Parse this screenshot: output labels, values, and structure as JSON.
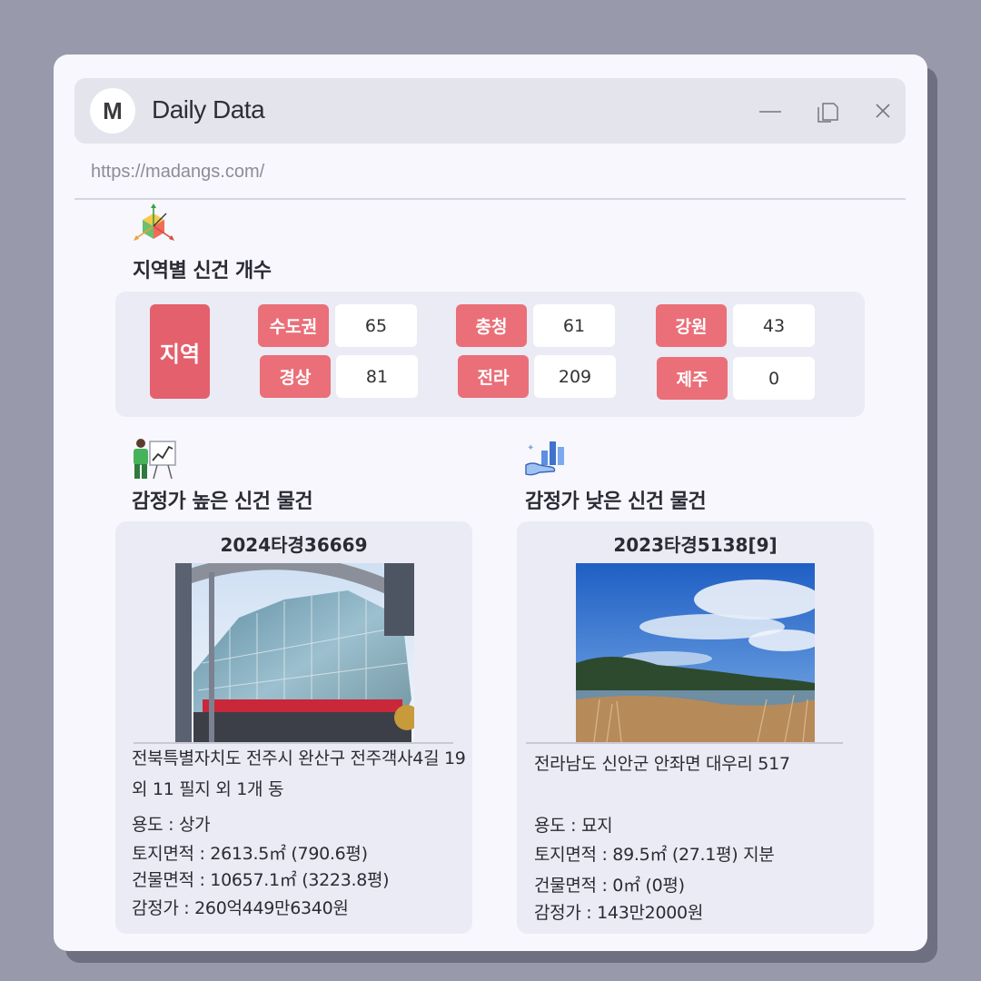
{
  "window": {
    "logo_letter": "M",
    "title": "Daily Data",
    "url": "https://madangs.com/"
  },
  "regions": {
    "section_title": "지역별 신건 개수",
    "label": "지역",
    "items": [
      {
        "name": "수도권",
        "count": "65"
      },
      {
        "name": "충청",
        "count": "61"
      },
      {
        "name": "강원",
        "count": "43"
      },
      {
        "name": "경상",
        "count": "81"
      },
      {
        "name": "전라",
        "count": "209"
      },
      {
        "name": "제주",
        "count": "0"
      }
    ]
  },
  "high": {
    "section_title": "감정가 높은 신건 물건",
    "case_no": "2024타경36669",
    "address": "전북특별자치도 전주시 완산구 전주객사4길 19 외 11 필지 외 1개 동",
    "use": "용도 : 상가",
    "land_area": "토지면적 : 2613.5㎡ (790.6평)",
    "building_area": "건물면적 : 10657.1㎡ (3223.8평)",
    "appraisal": "감정가 : 260억449만6340원"
  },
  "low": {
    "section_title": "감정가 낮은 신건 물건",
    "case_no": "2023타경5138[9]",
    "address": "전라남도 신안군 안좌면 대우리 517",
    "use": "용도 : 묘지",
    "land_area": "토지면적 : 89.5㎡ (27.1평) 지분",
    "building_area": "건물면적 : 0㎡ (0평)",
    "appraisal": "감정가 : 143만2000원"
  },
  "colors": {
    "accent": "#ea6f78",
    "panel": "#ebebf5",
    "background": "#9899aa"
  }
}
